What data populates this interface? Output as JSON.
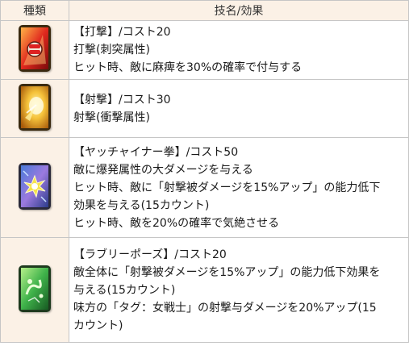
{
  "header": {
    "col_type": "種類",
    "col_effect": "技名/効果"
  },
  "skills": [
    {
      "icon": "fist-icon",
      "lines": [
        "【打撃】/コスト20",
        "打撃(刺突属性)",
        "ヒット時、敵に麻痺を30%の確率で付与する"
      ]
    },
    {
      "icon": "shot-icon",
      "lines": [
        "【射撃】/コスト30",
        "射撃(衝撃属性)"
      ]
    },
    {
      "icon": "burst-icon",
      "lines": [
        "【ヤッチャイナー拳】/コスト50",
        "敵に爆発属性の大ダメージを与える",
        "ヒット時、敵に「射撃被ダメージを15%アップ」の能力低下",
        "効果を与える(15カウント)",
        "ヒット時、敵を20%の確率で気絶させる"
      ]
    },
    {
      "icon": "pose-icon",
      "lines": [
        "【ラブリーポーズ】/コスト20",
        "敵全体に「射撃被ダメージを15%アップ」の能力低下効果を",
        "与える(15カウント)",
        "味方の「タグ：女戦士」の射撃与ダメージを20%アップ(15",
        "カウント)"
      ]
    }
  ]
}
